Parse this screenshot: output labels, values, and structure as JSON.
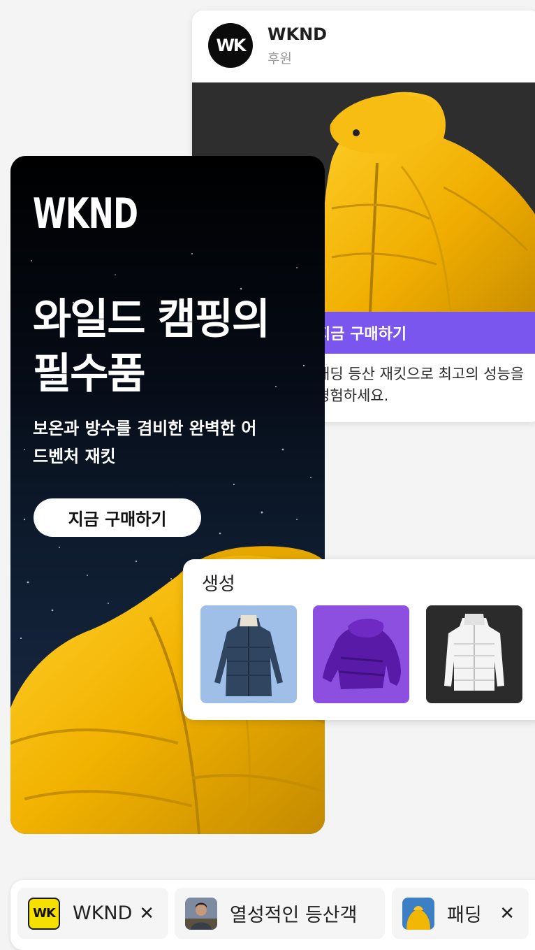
{
  "post": {
    "avatar_text": "WK",
    "brand_name": "WKND",
    "sponsored_label": "후원",
    "cta_label": "지금 구매하기",
    "caption": "패딩 등산 재킷으로 최고의 성능을 경험하세요."
  },
  "ad": {
    "logo": "WKND",
    "headline": "와일드 캠핑의 필수품",
    "subhead": "보온과 방수를 겸비한 완벽한 어드벤처 재킷",
    "button_label": "지금 구매하기"
  },
  "generated": {
    "title": "생성",
    "thumbnails": [
      {
        "icon": "navy-long-puffer-coat"
      },
      {
        "icon": "purple-puffer-jacket"
      },
      {
        "icon": "white-puffer-jacket"
      }
    ]
  },
  "tags": [
    {
      "icon_text": "WK",
      "label": "WKND",
      "close": "✕"
    },
    {
      "label": "열성적인 등산객",
      "close": "✕"
    },
    {
      "label": "패딩",
      "close": "✕"
    }
  ],
  "colors": {
    "accent_purple": "#7a55ee",
    "jacket_yellow": "#f2b705",
    "logo_yellow": "#f5e000"
  }
}
